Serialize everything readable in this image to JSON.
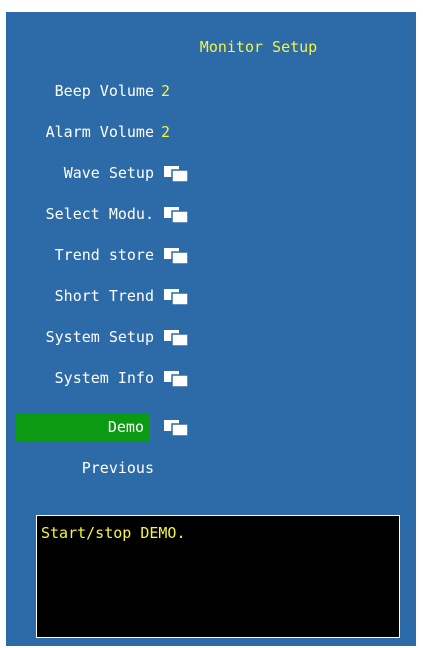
{
  "menu": {
    "title": "Monitor Setup",
    "items": [
      {
        "label": "Beep Volume",
        "value": "2"
      },
      {
        "label": "Alarm Volume",
        "value": "2"
      },
      {
        "label": "Wave Setup",
        "icon": "submenu-icon"
      },
      {
        "label": "Select Modu.",
        "icon": "submenu-icon"
      },
      {
        "label": "Trend store",
        "icon": "submenu-icon"
      },
      {
        "label": "Short Trend",
        "icon": "submenu-icon"
      },
      {
        "label": "System Setup",
        "icon": "submenu-icon"
      },
      {
        "label": "System Info",
        "icon": "submenu-icon"
      },
      {
        "label": "Demo",
        "icon": "submenu-icon",
        "selected": true
      },
      {
        "label": "Previous"
      }
    ]
  },
  "help_text": "Start/stop DEMO.",
  "colors": {
    "background": "#2d6aa8",
    "selected": "#0b9a12",
    "value_text": "#f5f542",
    "help_background": "#000000"
  }
}
